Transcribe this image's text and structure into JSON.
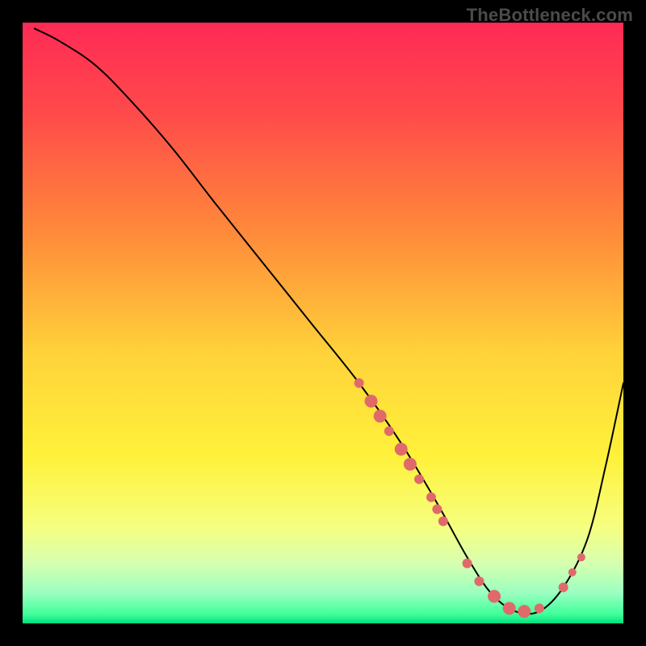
{
  "watermark": "TheBottleneck.com",
  "chart_data": {
    "type": "line",
    "title": "",
    "xlabel": "",
    "ylabel": "",
    "xlim": [
      0,
      100
    ],
    "ylim": [
      0,
      100
    ],
    "grid": false,
    "legend": false,
    "background_gradient": {
      "stops": [
        {
          "offset": 0.0,
          "color": "#ff2a55"
        },
        {
          "offset": 0.15,
          "color": "#ff4a4a"
        },
        {
          "offset": 0.35,
          "color": "#ff8a3a"
        },
        {
          "offset": 0.55,
          "color": "#ffd23a"
        },
        {
          "offset": 0.72,
          "color": "#fff13a"
        },
        {
          "offset": 0.84,
          "color": "#f6ff80"
        },
        {
          "offset": 0.9,
          "color": "#d6ffb0"
        },
        {
          "offset": 0.95,
          "color": "#9affc0"
        },
        {
          "offset": 0.985,
          "color": "#3fff9a"
        },
        {
          "offset": 1.0,
          "color": "#00e080"
        }
      ]
    },
    "series": [
      {
        "name": "curve",
        "color": "#000000",
        "stroke_width": 2,
        "x": [
          2,
          6,
          12,
          18,
          25,
          32,
          40,
          48,
          56,
          63,
          69,
          74,
          78,
          82,
          86,
          90,
          94,
          97,
          100
        ],
        "y": [
          99,
          97,
          93,
          87,
          79,
          70,
          60,
          50,
          40,
          30,
          20,
          11,
          5,
          2,
          2,
          6,
          14,
          26,
          40
        ]
      }
    ],
    "markers": {
      "color": "#e06a6a",
      "points": [
        {
          "x": 56,
          "y": 40,
          "r": 6
        },
        {
          "x": 58,
          "y": 37,
          "r": 8
        },
        {
          "x": 59.5,
          "y": 34.5,
          "r": 8
        },
        {
          "x": 61,
          "y": 32,
          "r": 6
        },
        {
          "x": 63,
          "y": 29,
          "r": 8
        },
        {
          "x": 64.5,
          "y": 26.5,
          "r": 8
        },
        {
          "x": 66,
          "y": 24,
          "r": 6
        },
        {
          "x": 68,
          "y": 21,
          "r": 6
        },
        {
          "x": 69,
          "y": 19,
          "r": 6
        },
        {
          "x": 70,
          "y": 17,
          "r": 6
        },
        {
          "x": 74,
          "y": 10,
          "r": 6
        },
        {
          "x": 76,
          "y": 7,
          "r": 6
        },
        {
          "x": 78.5,
          "y": 4.5,
          "r": 8
        },
        {
          "x": 81,
          "y": 2.5,
          "r": 8
        },
        {
          "x": 83.5,
          "y": 2,
          "r": 8
        },
        {
          "x": 86,
          "y": 2.5,
          "r": 6
        },
        {
          "x": 90,
          "y": 6,
          "r": 6
        },
        {
          "x": 91.5,
          "y": 8.5,
          "r": 5
        },
        {
          "x": 93,
          "y": 11,
          "r": 5
        }
      ]
    }
  }
}
